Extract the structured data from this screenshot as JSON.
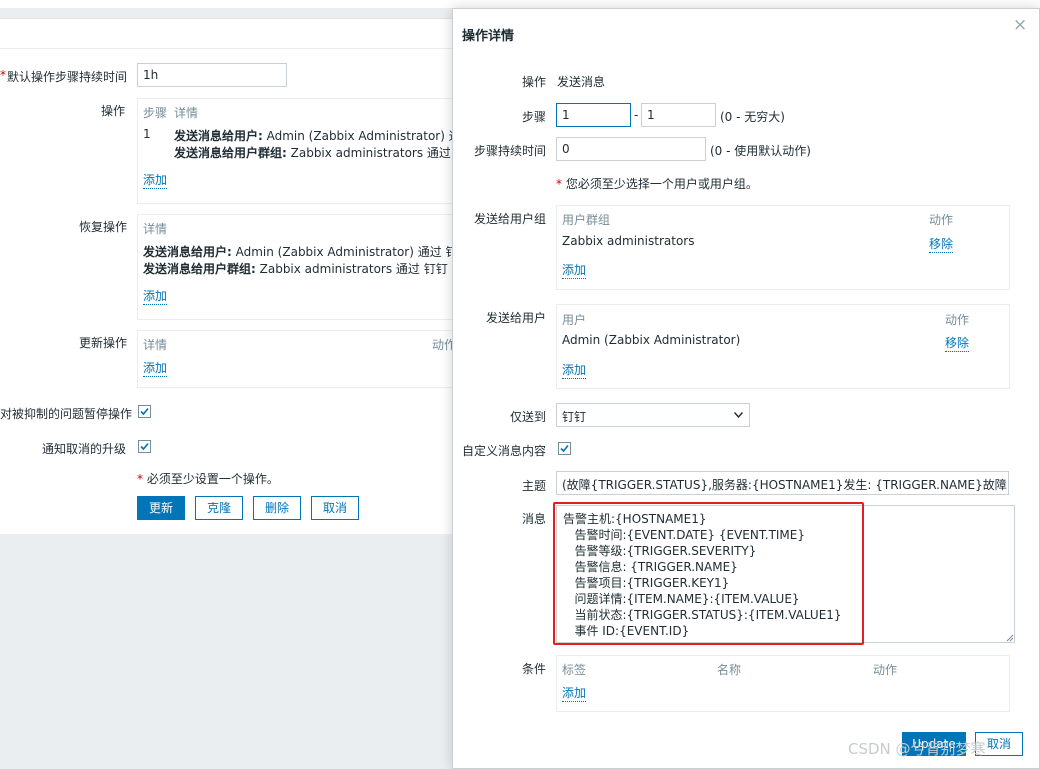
{
  "bg": {
    "default_duration_label": "默认操作步骤持续时间",
    "default_duration_value": "1h",
    "operations_label": "操作",
    "ops_col_step": "步骤",
    "ops_col_details": "详情",
    "ops_row_step": "1",
    "ops_row_line1_bold": "发送消息给用户:",
    "ops_row_line1_text": " Admin (Zabbix Administrator) 通过",
    "ops_row_line2_bold": "发送消息给用户群组:",
    "ops_row_line2_text": " Zabbix administrators 通过 钉钉",
    "ops_add": "添加",
    "recovery_label": "恢复操作",
    "rec_col_details": "详情",
    "rec_line1_bold": "发送消息给用户:",
    "rec_line1_text": " Admin (Zabbix Administrator) 通过 钉钉",
    "rec_line2_bold": "发送消息给用户群组:",
    "rec_line2_text": " Zabbix administrators 通过 钉钉",
    "rec_add": "添加",
    "update_label": "更新操作",
    "upd_col_details": "详情",
    "upd_col_action": "动作",
    "upd_add": "添加",
    "pause_label": "对被抑制的问题暂停操作",
    "notify_cancel_label": "通知取消的升级",
    "must_note": "必须至少设置一个操作。",
    "buttons": {
      "update": "更新",
      "clone": "克隆",
      "delete": "删除",
      "cancel": "取消"
    }
  },
  "dialog": {
    "title": "操作详情",
    "close": "×",
    "operation_label": "操作",
    "operation_value": "发送消息",
    "steps_label": "步骤",
    "step_from": "1",
    "step_dash": "-",
    "step_to": "1",
    "step_hint": "(0 - 无穷大)",
    "duration_label": "步骤持续时间",
    "duration_value": "0",
    "duration_hint": "(0 - 使用默认动作)",
    "must_note": "您必须至少选择一个用户或用户组。",
    "send_groups_label": "发送给用户组",
    "groups_col": "用户群组",
    "groups_action_col": "动作",
    "groups_row": "Zabbix administrators",
    "groups_remove": "移除",
    "groups_add": "添加",
    "send_users_label": "发送给用户",
    "users_col": "用户",
    "users_action_col": "动作",
    "users_row": "Admin (Zabbix Administrator)",
    "users_remove": "移除",
    "users_add": "添加",
    "only_to_label": "仅送到",
    "only_to_value": "钉钉",
    "custom_msg_label": "自定义消息内容",
    "subject_label": "主题",
    "subject_value": "(故障{TRIGGER.STATUS},服务器:{HOSTNAME1}发生: {TRIGGER.NAME}故障!)",
    "message_label": "消息",
    "message_lines": [
      "告警主机:{HOSTNAME1}",
      "   告警时间:{EVENT.DATE} {EVENT.TIME}",
      "   告警等级:{TRIGGER.SEVERITY}",
      "   告警信息: {TRIGGER.NAME}",
      "   告警项目:{TRIGGER.KEY1}",
      "   问题详情:{ITEM.NAME}:{ITEM.VALUE}",
      "   当前状态:{TRIGGER.STATUS}:{ITEM.VALUE1}",
      "   事件 ID:{EVENT.ID}"
    ],
    "conditions_label": "条件",
    "cond_col_label": "标签",
    "cond_col_name": "名称",
    "cond_col_action": "动作",
    "cond_add": "添加",
    "btn_update": "Update",
    "btn_cancel": "取消"
  },
  "watermark": "CSDN @兮背别梦寒",
  "colors": {
    "accent": "#0275b8",
    "highlight_box": "#e02020",
    "required": "#d40000"
  }
}
